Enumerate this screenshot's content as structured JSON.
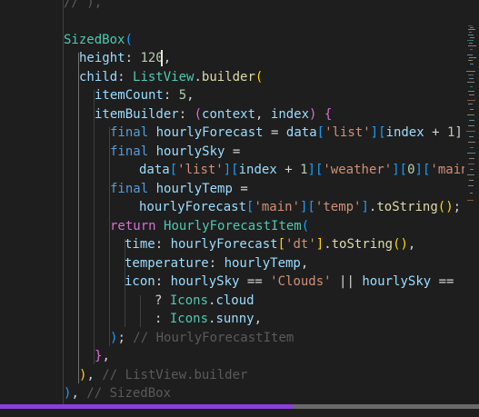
{
  "code": {
    "l0": {
      "text": "// ),",
      "style": "dim"
    },
    "l1": [
      {
        "t": "SizedBox",
        "c": "cls"
      },
      {
        "t": "(",
        "c": "b3"
      }
    ],
    "l2": [
      {
        "t": "height",
        "c": "var"
      },
      {
        "t": ": ",
        "c": ""
      },
      {
        "t": "120",
        "c": "num"
      },
      {
        "t": ",",
        "c": ""
      }
    ],
    "l3": [
      {
        "t": "child",
        "c": "var"
      },
      {
        "t": ": ",
        "c": ""
      },
      {
        "t": "ListView",
        "c": "cls"
      },
      {
        "t": ".",
        "c": ""
      },
      {
        "t": "builder",
        "c": "fn"
      },
      {
        "t": "(",
        "c": "b1"
      }
    ],
    "l4": [
      {
        "t": "itemCount",
        "c": "var"
      },
      {
        "t": ": ",
        "c": ""
      },
      {
        "t": "5",
        "c": "num"
      },
      {
        "t": ",",
        "c": ""
      }
    ],
    "l5": [
      {
        "t": "itemBuilder",
        "c": "var"
      },
      {
        "t": ": ",
        "c": ""
      },
      {
        "t": "(",
        "c": "b2"
      },
      {
        "t": "context",
        "c": "var"
      },
      {
        "t": ", ",
        "c": ""
      },
      {
        "t": "index",
        "c": "var"
      },
      {
        "t": ")",
        "c": "b2"
      },
      {
        "t": " ",
        "c": ""
      },
      {
        "t": "{",
        "c": "b2"
      }
    ],
    "l6": [
      {
        "t": "final",
        "c": "kw"
      },
      {
        "t": " ",
        "c": ""
      },
      {
        "t": "hourlyForecast",
        "c": "var"
      },
      {
        "t": " = ",
        "c": ""
      },
      {
        "t": "data",
        "c": "var"
      },
      {
        "t": "[",
        "c": "b3"
      },
      {
        "t": "'list'",
        "c": "str"
      },
      {
        "t": "]",
        "c": "b3"
      },
      {
        "t": "[",
        "c": "b3"
      },
      {
        "t": "index",
        "c": "var"
      },
      {
        "t": " + ",
        "c": ""
      },
      {
        "t": "1",
        "c": "num"
      },
      {
        "t": "];",
        "c": ""
      }
    ],
    "l7": [
      {
        "t": "final",
        "c": "kw"
      },
      {
        "t": " ",
        "c": ""
      },
      {
        "t": "hourlySky",
        "c": "var"
      },
      {
        "t": " =",
        "c": ""
      }
    ],
    "l8": [
      {
        "t": "data",
        "c": "var"
      },
      {
        "t": "[",
        "c": "b3"
      },
      {
        "t": "'list'",
        "c": "str"
      },
      {
        "t": "]",
        "c": "b3"
      },
      {
        "t": "[",
        "c": "b3"
      },
      {
        "t": "index",
        "c": "var"
      },
      {
        "t": " + ",
        "c": ""
      },
      {
        "t": "1",
        "c": "num"
      },
      {
        "t": "]",
        "c": "b3"
      },
      {
        "t": "[",
        "c": "b3"
      },
      {
        "t": "'weather'",
        "c": "str"
      },
      {
        "t": "]",
        "c": "b3"
      },
      {
        "t": "[",
        "c": "b3"
      },
      {
        "t": "0",
        "c": "num"
      },
      {
        "t": "]",
        "c": "b3"
      },
      {
        "t": "[",
        "c": "b3"
      },
      {
        "t": "'main",
        "c": "str"
      }
    ],
    "l9": [
      {
        "t": "final",
        "c": "kw"
      },
      {
        "t": " ",
        "c": ""
      },
      {
        "t": "hourlyTemp",
        "c": "var"
      },
      {
        "t": " =",
        "c": ""
      }
    ],
    "l10": [
      {
        "t": "hourlyForecast",
        "c": "var"
      },
      {
        "t": "[",
        "c": "b3"
      },
      {
        "t": "'main'",
        "c": "str"
      },
      {
        "t": "]",
        "c": "b3"
      },
      {
        "t": "[",
        "c": "b3"
      },
      {
        "t": "'temp'",
        "c": "str"
      },
      {
        "t": "]",
        "c": "b3"
      },
      {
        "t": ".",
        "c": ""
      },
      {
        "t": "toString",
        "c": "fn"
      },
      {
        "t": "()",
        "c": "b1"
      },
      {
        "t": ";",
        "c": ""
      }
    ],
    "l11": [
      {
        "t": "return",
        "c": "b2"
      },
      {
        "t": " ",
        "c": ""
      },
      {
        "t": "HourlyForecastItem",
        "c": "cls"
      },
      {
        "t": "(",
        "c": "b3"
      }
    ],
    "l12": [
      {
        "t": "time",
        "c": "var"
      },
      {
        "t": ": ",
        "c": ""
      },
      {
        "t": "hourlyForecast",
        "c": "var"
      },
      {
        "t": "[",
        "c": "b1"
      },
      {
        "t": "'dt'",
        "c": "str"
      },
      {
        "t": "]",
        "c": "b1"
      },
      {
        "t": ".",
        "c": ""
      },
      {
        "t": "toString",
        "c": "fn"
      },
      {
        "t": "()",
        "c": "b1"
      },
      {
        "t": ",",
        "c": ""
      }
    ],
    "l13": [
      {
        "t": "temperature",
        "c": "var"
      },
      {
        "t": ": ",
        "c": ""
      },
      {
        "t": "hourlyTemp",
        "c": "var"
      },
      {
        "t": ",",
        "c": ""
      }
    ],
    "l14": [
      {
        "t": "icon",
        "c": "var"
      },
      {
        "t": ": ",
        "c": ""
      },
      {
        "t": "hourlySky",
        "c": "var"
      },
      {
        "t": " == ",
        "c": ""
      },
      {
        "t": "'Clouds'",
        "c": "str"
      },
      {
        "t": " || ",
        "c": ""
      },
      {
        "t": "hourlySky",
        "c": "var"
      },
      {
        "t": " == ",
        "c": ""
      },
      {
        "t": "'",
        "c": "str"
      }
    ],
    "l15": [
      {
        "t": "? ",
        "c": ""
      },
      {
        "t": "Icons",
        "c": "cls"
      },
      {
        "t": ".",
        "c": ""
      },
      {
        "t": "cloud",
        "c": "var"
      }
    ],
    "l16": [
      {
        "t": ": ",
        "c": ""
      },
      {
        "t": "Icons",
        "c": "cls"
      },
      {
        "t": ".",
        "c": ""
      },
      {
        "t": "sunny",
        "c": "var"
      },
      {
        "t": ",",
        "c": ""
      }
    ],
    "l17": [
      {
        "t": ")",
        "c": "b3"
      },
      {
        "t": "; ",
        "c": ""
      },
      {
        "t": "// HourlyForecastItem",
        "c": "dim"
      }
    ],
    "l18": [
      {
        "t": "}",
        "c": "b2"
      },
      {
        "t": ",",
        "c": ""
      }
    ],
    "l19": [
      {
        "t": ")",
        "c": "b1"
      },
      {
        "t": ", ",
        "c": ""
      },
      {
        "t": "// ListView.builder",
        "c": "dim"
      }
    ],
    "l20": [
      {
        "t": ")",
        "c": "b3"
      },
      {
        "t": ", ",
        "c": ""
      },
      {
        "t": "// SizedBox",
        "c": "dim"
      }
    ]
  },
  "colors": {
    "background": "#1e1e1e",
    "scrollbar_thumb": "#8b3fd9"
  }
}
